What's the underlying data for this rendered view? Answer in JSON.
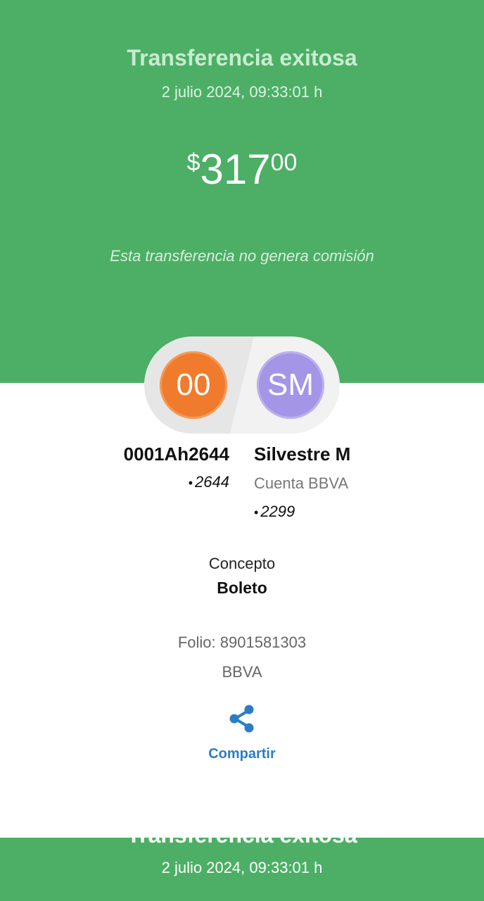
{
  "header": {
    "title": "Transferencia exitosa",
    "datetime": "2 julio 2024, 09:33:01 h",
    "amount": {
      "currency": "$",
      "integer": "317",
      "decimals": "00"
    },
    "fee_note": "Esta transferencia no genera comisión"
  },
  "origin": {
    "initials": "00",
    "name": "0001Ah2644",
    "bullet": "•",
    "account": "2644"
  },
  "destination": {
    "initials": "SM",
    "name": "Silvestre M",
    "bank": "Cuenta BBVA",
    "bullet": "•",
    "account": "2299"
  },
  "concept": {
    "label": "Concepto",
    "value": "Boleto"
  },
  "folio": "Folio: 8901581303",
  "bank": "BBVA",
  "share": {
    "label": "Compartir",
    "icon": "share-icon"
  },
  "footer": {
    "title": "Transferencia exitosa",
    "datetime": "2 julio 2024, 09:33:01 h"
  },
  "colors": {
    "brand_green": "#4caf65",
    "origin_avatar": "#f07b2d",
    "destination_avatar": "#a595e6",
    "link_blue": "#2a7ec5"
  }
}
